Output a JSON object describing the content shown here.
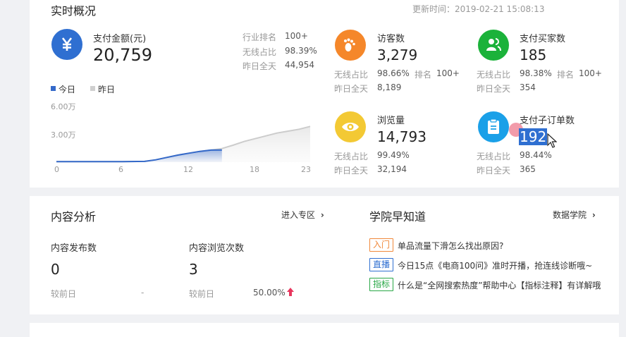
{
  "realtime": {
    "title": "实时概况",
    "update_time": "更新时间：2019-02-21 15:08:13",
    "payment": {
      "label": "支付金额(元)",
      "value": "20,759",
      "stats": [
        {
          "label": "行业排名",
          "value": "100+"
        },
        {
          "label": "无线占比",
          "value": "98.39%"
        },
        {
          "label": "昨日全天",
          "value": "44,954"
        }
      ]
    },
    "legend": {
      "today": "今日",
      "yesterday": "昨日"
    },
    "chart_ylabels": [
      "6.00万",
      "3.00万"
    ],
    "chart_xlabels": [
      "0",
      "6",
      "12",
      "18",
      "23"
    ],
    "metrics": [
      {
        "label": "访客数",
        "value": "3,279",
        "wireless_label": "无线占比",
        "wireless": "98.66%",
        "rank_label": "排名",
        "rank": "100+",
        "yesterday_label": "昨日全天",
        "yesterday": "8,189",
        "icon": "footprint-icon",
        "color": "#f5872a"
      },
      {
        "label": "支付买家数",
        "value": "185",
        "wireless_label": "无线占比",
        "wireless": "98.38%",
        "rank_label": "排名",
        "rank": "100+",
        "yesterday_label": "昨日全天",
        "yesterday": "354",
        "icon": "buyers-icon",
        "color": "#1bb23a"
      },
      {
        "label": "浏览量",
        "value": "14,793",
        "wireless_label": "无线占比",
        "wireless": "99.49%",
        "yesterday_label": "昨日全天",
        "yesterday": "32,194",
        "icon": "eye-icon",
        "color": "#f3c934"
      },
      {
        "label": "支付子订单数",
        "value": "192",
        "wireless_label": "无线占比",
        "wireless": "98.44%",
        "yesterday_label": "昨日全天",
        "yesterday": "365",
        "icon": "clipboard-icon",
        "color": "#1aa0e8"
      }
    ],
    "colors": {
      "payment_icon": "#2f6fd1",
      "today_line": "#3469c9",
      "yesterday_line": "#cccccc"
    }
  },
  "chart_data": {
    "type": "area",
    "x": [
      0,
      2,
      4,
      6,
      8,
      9,
      10,
      11,
      12,
      13,
      14,
      15,
      16,
      17,
      18,
      19,
      20,
      21,
      22,
      23
    ],
    "ylim": [
      0,
      60000
    ],
    "series": [
      {
        "name": "今日",
        "values": [
          500,
          500,
          600,
          600,
          800,
          2500,
          5000,
          7500,
          9500,
          11500,
          12800,
          13000
        ]
      },
      {
        "name": "昨日",
        "values": [
          500,
          500,
          600,
          600,
          800,
          2500,
          5000,
          7500,
          9500,
          11500,
          12800,
          14500,
          18000,
          22000,
          25000,
          28000,
          31000,
          33000,
          35000,
          38000
        ]
      }
    ]
  },
  "content": {
    "title": "内容分析",
    "link": "进入专区",
    "published_label": "内容发布数",
    "published_value": "0",
    "published_compare_label": "较前日",
    "published_compare": "-",
    "views_label": "内容浏览次数",
    "views_value": "3",
    "views_compare_label": "较前日",
    "views_compare": "50.00%"
  },
  "academy": {
    "title": "学院早知道",
    "link": "数据学院",
    "news": [
      {
        "tag": "入门",
        "tag_color": "#f0883a",
        "text": "单品流量下滑怎么找出原因?"
      },
      {
        "tag": "直播",
        "tag_color": "#2f6fd1",
        "text": "今日15点《电商100问》准时开播，抢连线诊断哦~"
      },
      {
        "tag": "指标",
        "tag_color": "#28a745",
        "text": "什么是“全网搜索热度”帮助中心【指标注释】有详解哦"
      }
    ]
  }
}
